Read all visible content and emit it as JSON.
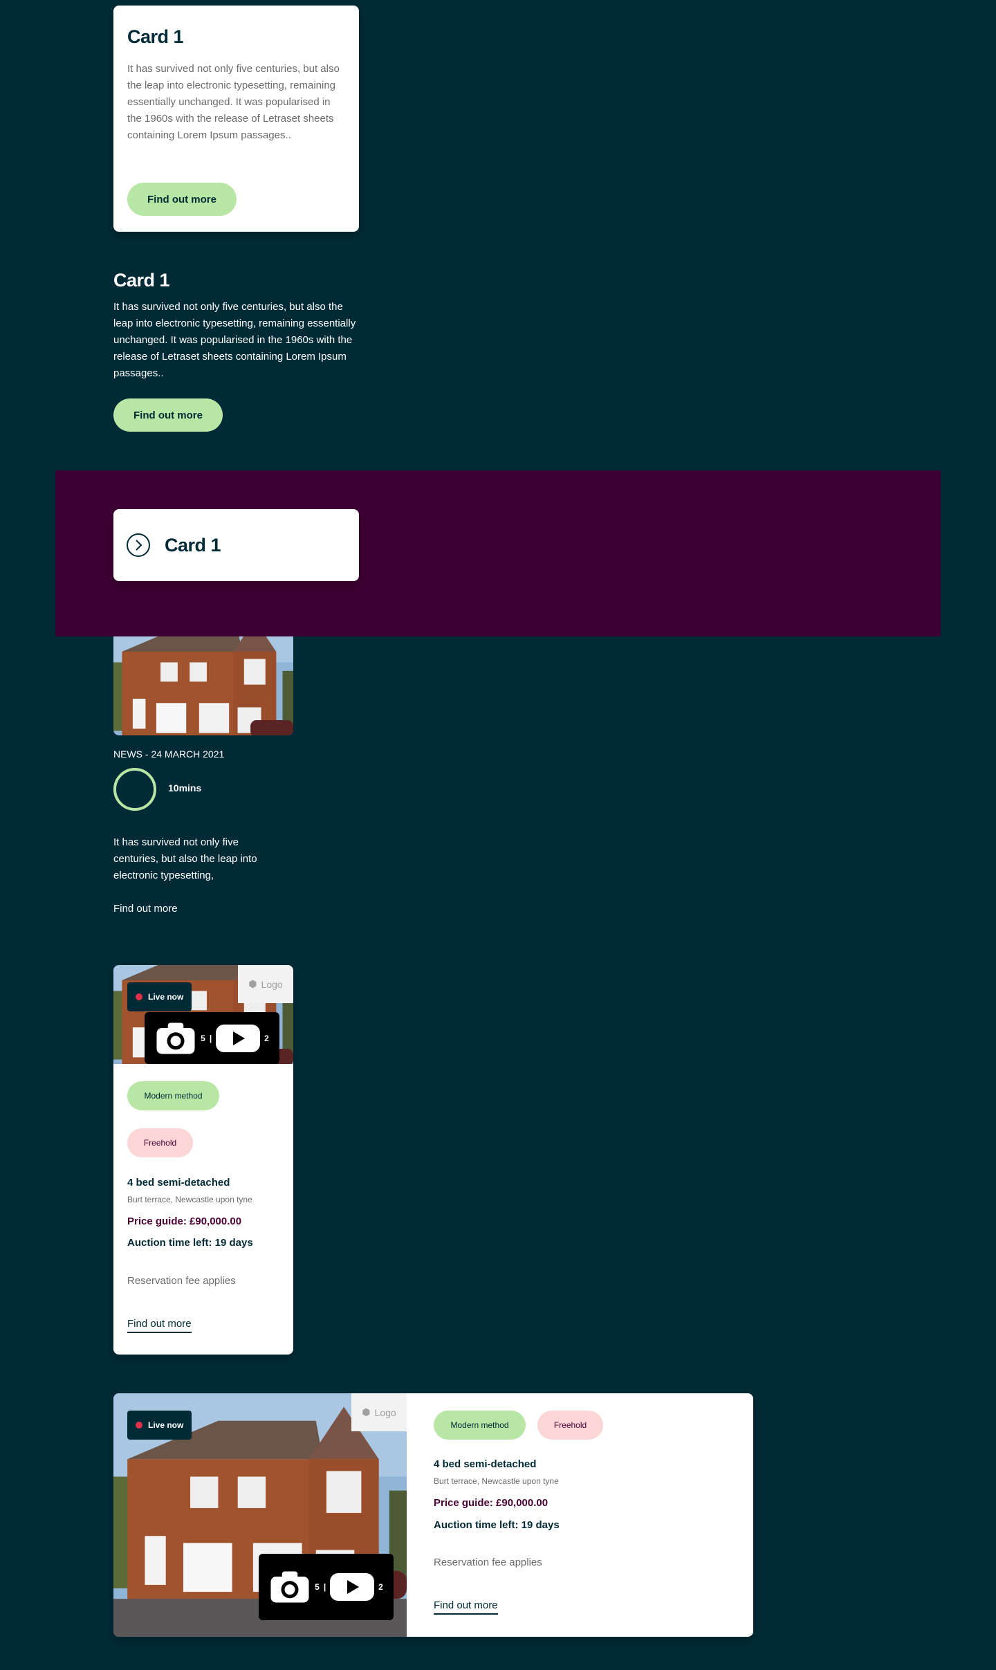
{
  "card_a": {
    "title": "Card 1",
    "body": "It has survived not only five centuries, but also the leap into electronic typesetting, remaining essentially unchanged. It was popularised in the 1960s with the release of Letraset sheets containing Lorem Ipsum passages..",
    "button": "Find out more"
  },
  "card_b": {
    "title": "Card 1",
    "body": "It has survived not only five centuries, but also the leap into electronic typesetting, remaining essentially unchanged. It was popularised in the 1960s with the release of Letraset sheets containing Lorem Ipsum passages..",
    "button": "Find out more"
  },
  "card_c": {
    "title": "Card 1",
    "icon": "chevron-right-circle-icon"
  },
  "news": {
    "meta": "NEWS - 24 MARCH 2021",
    "read_time": "10mins",
    "body": "It has survived not only five centuries, but also the leap into electronic typesetting,",
    "link": "Find out more"
  },
  "property_v": {
    "live": "Live now",
    "logo": "Logo",
    "photos": "5",
    "videos": "2",
    "tags": [
      "Modern method",
      "Freehold"
    ],
    "title": "4 bed semi-detached",
    "address": "Burt terrace, Newcastle upon tyne",
    "price": "Price guide: £90,000.00",
    "time_left": "Auction time left: 19 days",
    "fee": "Reservation fee applies",
    "link": "Find out more"
  },
  "property_h": {
    "live": "Live now",
    "logo": "Logo",
    "photos": "5",
    "videos": "2",
    "tags": [
      "Modern method",
      "Freehold"
    ],
    "title": "4 bed semi-detached",
    "address": "Burt terrace, Newcastle upon tyne",
    "price": "Price guide: £90,000.00",
    "time_left": "Auction time left: 19 days",
    "fee": "Reservation fee applies",
    "link": "Find out more"
  },
  "colors": {
    "background": "#002b36",
    "accent_green": "#b8e6a5",
    "accent_pink": "#fcd6d6",
    "purple_band": "#3d0033",
    "live_dot": "#e2304a"
  }
}
